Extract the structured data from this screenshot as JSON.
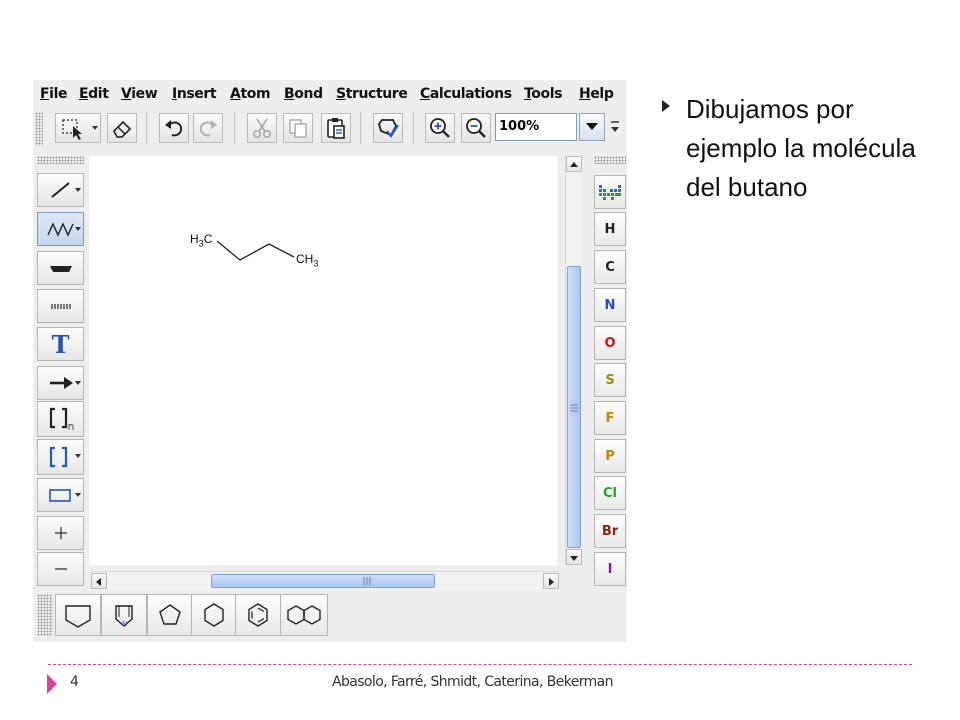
{
  "menu": [
    {
      "label_u": "F",
      "label_rest": "ile"
    },
    {
      "label_u": "E",
      "label_rest": "dit"
    },
    {
      "label_u": "V",
      "label_rest": "iew"
    },
    {
      "label_u": "I",
      "label_rest": "nsert"
    },
    {
      "label_u": "A",
      "label_rest": "tom"
    },
    {
      "label_u": "B",
      "label_rest": "ond"
    },
    {
      "label_u": "S",
      "label_rest": "tructure"
    },
    {
      "label_u": "C",
      "label_rest": "alculations"
    },
    {
      "label_u": "T",
      "label_rest": "ools"
    },
    {
      "label_u": "H",
      "label_rest": "elp"
    }
  ],
  "toolbar": {
    "zoom_value": "100%"
  },
  "left_tools": {
    "text_tool_label": "T"
  },
  "molecule": {
    "left_group": {
      "main": "H",
      "sub": "3",
      "tail": "C"
    },
    "right_group": {
      "main": "CH",
      "sub": "3"
    }
  },
  "elements": [
    "H",
    "C",
    "N",
    "O",
    "S",
    "F",
    "P",
    "Cl",
    "Br",
    "I"
  ],
  "element_colors": {
    "H": "#1f1f1f",
    "C": "#1f1f1f",
    "N": "#2e46c7",
    "O": "#e01010",
    "S": "#9a8d00",
    "F": "#c8820a",
    "P": "#c8820a",
    "Cl": "#1fa51f",
    "Br": "#8a2410",
    "I": "#8b14a8"
  },
  "slide": {
    "bullet": "Dibujamos por ejemplo la molécula del butano",
    "page_number": "4",
    "authors": "Abasolo, Farré, Shmidt, Caterina, Bekerman"
  },
  "colors": {
    "accent": "#d4459b"
  }
}
